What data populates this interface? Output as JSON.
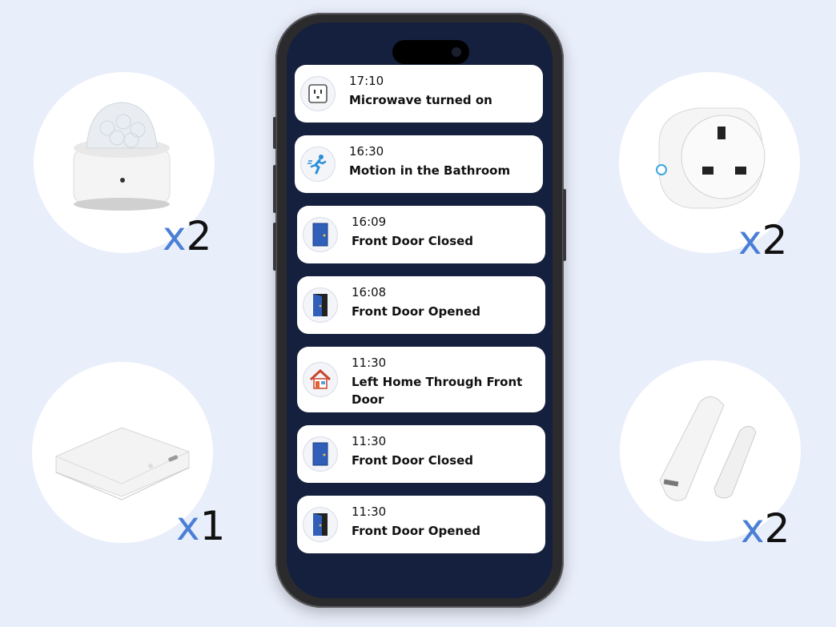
{
  "devices": [
    {
      "name": "motion-sensor",
      "quantity": "2"
    },
    {
      "name": "hub",
      "quantity": "1"
    },
    {
      "name": "smart-plug",
      "quantity": "2"
    },
    {
      "name": "door-sensor",
      "quantity": "2"
    }
  ],
  "quantity_prefix": "x",
  "colors": {
    "background": "#e9eefb",
    "accent": "#4a7fd6",
    "screen": "#14203d",
    "door": "#2f5fb8"
  },
  "notifications": [
    {
      "time": "17:10",
      "title": "Microwave turned on",
      "icon": "outlet-icon"
    },
    {
      "time": "16:30",
      "title": "Motion in the Bathroom",
      "icon": "running-person-icon"
    },
    {
      "time": "16:09",
      "title": "Front Door Closed",
      "icon": "door-closed-icon"
    },
    {
      "time": "16:08",
      "title": "Front Door Opened",
      "icon": "door-open-icon"
    },
    {
      "time": "11:30",
      "title": "Left Home Through Front Door",
      "icon": "house-icon"
    },
    {
      "time": "11:30",
      "title": "Front Door Closed",
      "icon": "door-closed-icon"
    },
    {
      "time": "11:30",
      "title": "Front Door Opened",
      "icon": "door-open-icon"
    }
  ]
}
